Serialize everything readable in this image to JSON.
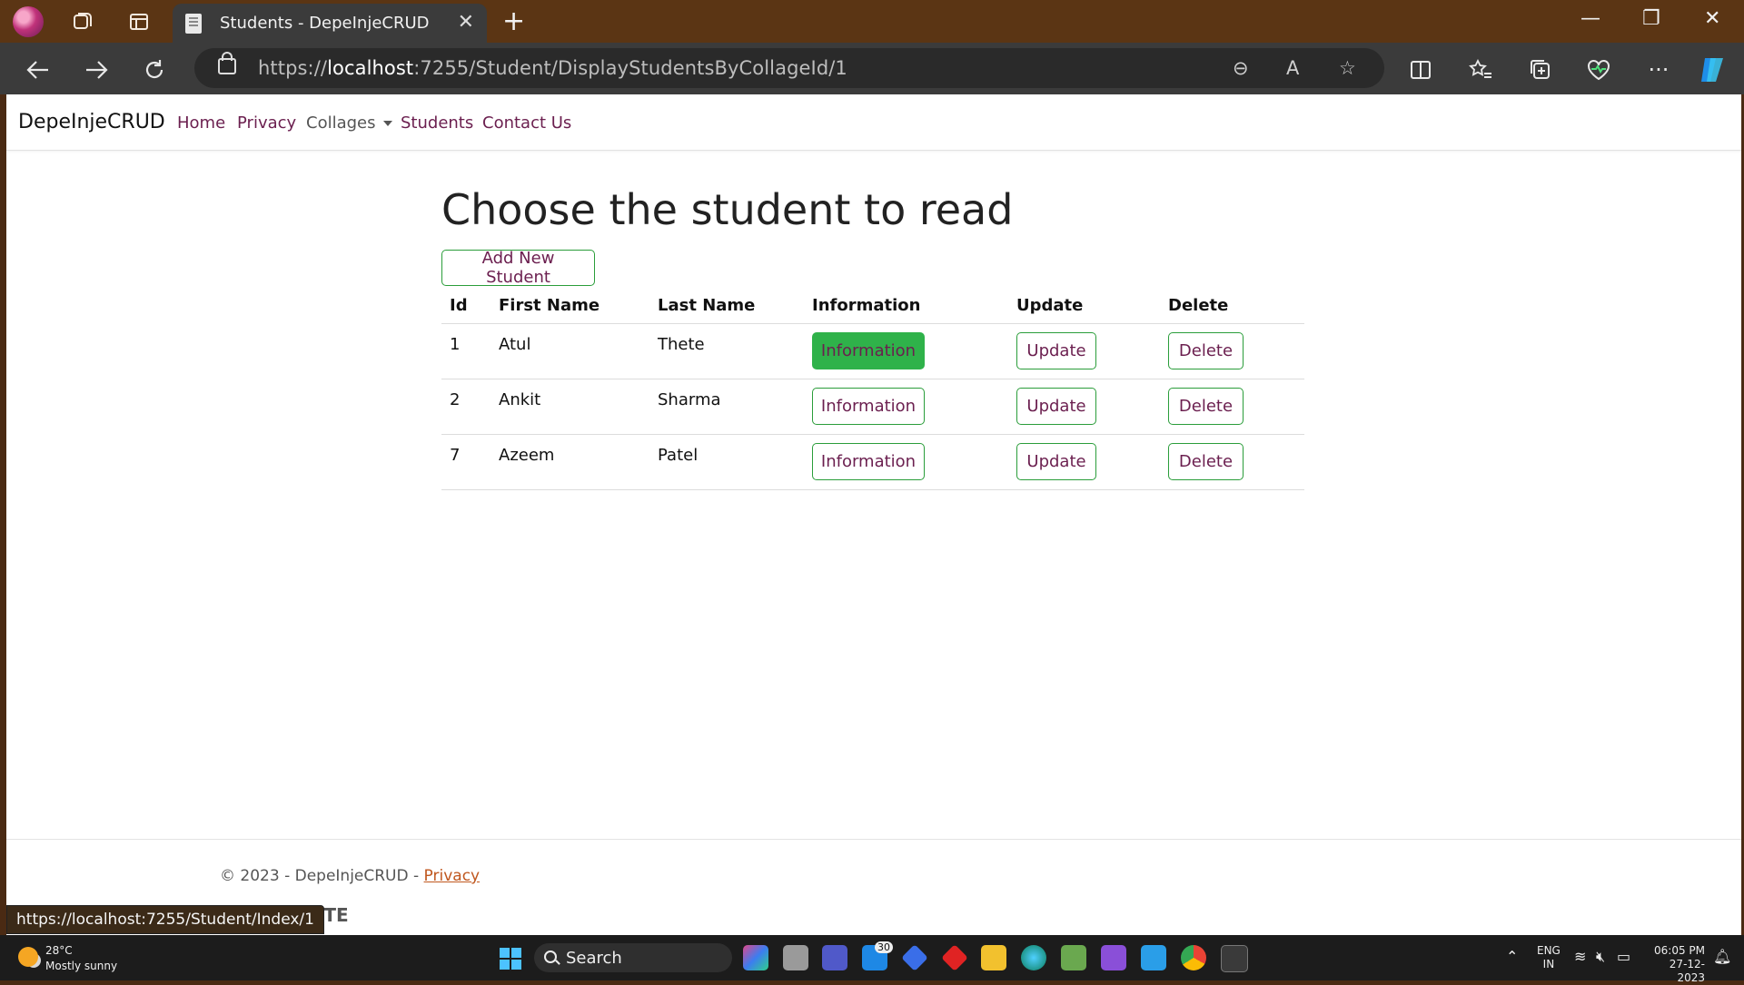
{
  "browser": {
    "tab_title": "Students - DepeInjeCRUD",
    "url_prefix": "https://",
    "url_host": "localhost",
    "url_rest": ":7255/Student/DisplayStudentsByCollageId/1",
    "status_url": "https://localhost:7255/Student/Index/1"
  },
  "navbar": {
    "brand": "DepeInjeCRUD",
    "links": {
      "home": "Home",
      "privacy": "Privacy",
      "collages": "Collages",
      "students": "Students",
      "contact": "Contact Us"
    }
  },
  "main": {
    "title": "Choose the student to read",
    "add_button": "Add New Student",
    "columns": [
      "Id",
      "First Name",
      "Last Name",
      "Information",
      "Update",
      "Delete"
    ],
    "rows": [
      {
        "id": "1",
        "first": "Atul",
        "last": "Thete",
        "info": "Information",
        "update": "Update",
        "delete": "Delete"
      },
      {
        "id": "2",
        "first": "Ankit",
        "last": "Sharma",
        "info": "Information",
        "update": "Update",
        "delete": "Delete"
      },
      {
        "id": "7",
        "first": "Azeem",
        "last": "Patel",
        "info": "Information",
        "update": "Update",
        "delete": "Delete"
      }
    ]
  },
  "footer": {
    "copyright": "© 2023 - DepeInjeCRUD - ",
    "privacy_link": "Privacy",
    "partial_text": "HETE"
  },
  "taskbar": {
    "weather_temp": "28°C",
    "weather_desc": "Mostly sunny",
    "search_label": "Search",
    "mail_badge": "30",
    "lang_top": "ENG",
    "lang_bottom": "IN",
    "time": "06:05 PM",
    "date": "27-12-2023"
  },
  "colors": {
    "accent_green": "#2fb24a",
    "link_purple": "#6b1f4f",
    "browser_frame": "#5b3514"
  }
}
